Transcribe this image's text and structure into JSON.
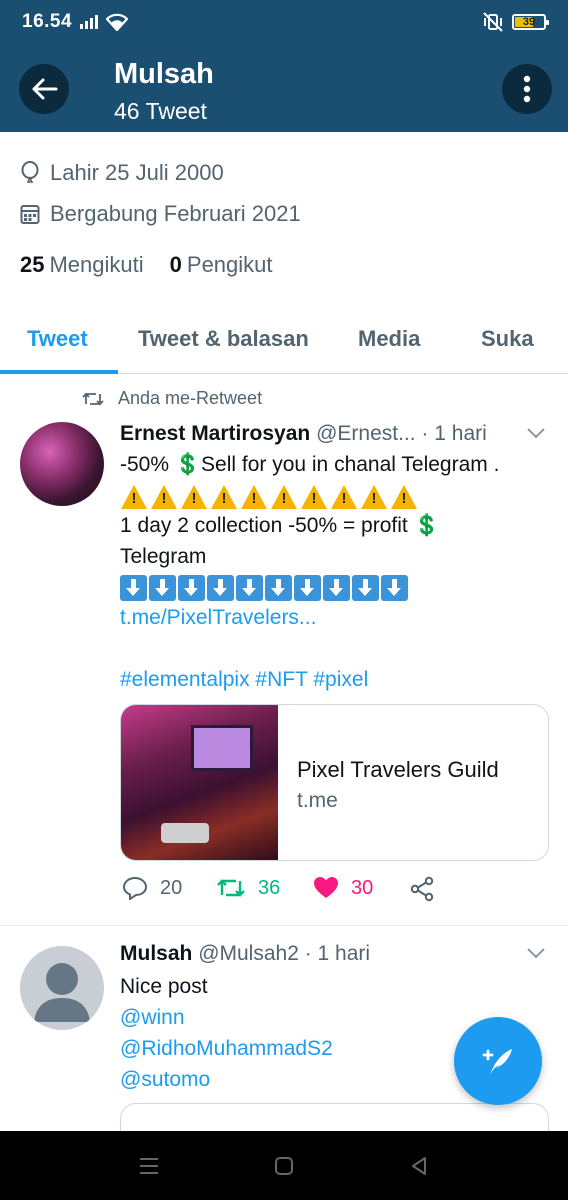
{
  "status_bar": {
    "time": "16.54",
    "battery": "39"
  },
  "header": {
    "title": "Mulsah",
    "subtitle": "46 Tweet"
  },
  "profile": {
    "birth": "Lahir 25 Juli 2000",
    "joined": "Bergabung Februari 2021",
    "following_count": "25",
    "following_label": "Mengikuti",
    "followers_count": "0",
    "followers_label": "Pengikut"
  },
  "tabs": [
    {
      "label": "Tweet",
      "active": true
    },
    {
      "label": "Tweet & balasan",
      "active": false
    },
    {
      "label": "Media",
      "active": false
    },
    {
      "label": "Suka",
      "active": false
    }
  ],
  "tweet1": {
    "retweet_label": "Anda me-Retweet",
    "name": "Ernest Martirosyan",
    "handle_time": "@Ernest... · 1 hari",
    "line1": "-50%  💲Sell for you in chanal Telegram .",
    "warning_count": 10,
    "line2": "1 day 2 collection -50% = profit  💲",
    "line3": "Telegram",
    "down_count": 10,
    "link": "t.me/PixelTravelers...",
    "hashtags": "#elementalpix #NFT #pixel",
    "card_title": "Pixel Travelers Guild",
    "card_domain": "t.me",
    "replies": "20",
    "retweets": "36",
    "likes": "30"
  },
  "tweet2": {
    "name": "Mulsah",
    "handle_time": "@Mulsah2 · 1 hari",
    "text": "Nice post",
    "mention1": "@winn",
    "mention2": "@RidhoMuhammadS2",
    "mention3": "@sutomo"
  },
  "colors": {
    "header_bg": "#1b4f72",
    "accent": "#1d9bf0",
    "retweet": "#00ba7c",
    "like": "#f91880"
  }
}
